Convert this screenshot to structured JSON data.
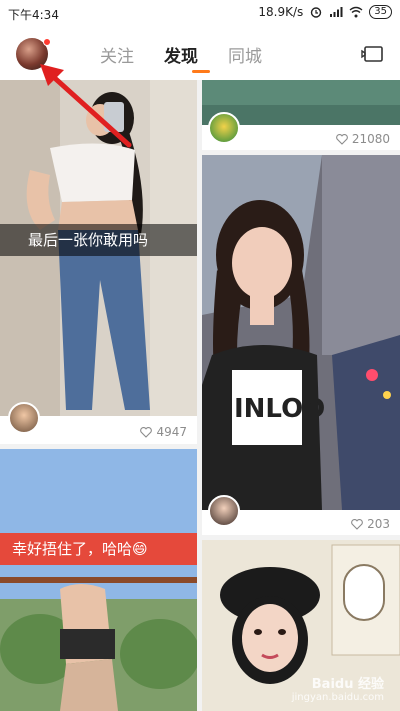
{
  "status_bar": {
    "time": "下午4:34",
    "speed": "18.9K/s",
    "battery": "35"
  },
  "nav": {
    "tabs": [
      {
        "label": "关注",
        "active": false
      },
      {
        "label": "发现",
        "active": true
      },
      {
        "label": "同城",
        "active": false
      }
    ],
    "accent": "#ff7a1a"
  },
  "feed": {
    "cards": [
      {
        "caption": "最后一张你敢用吗",
        "likes": "4947"
      },
      {
        "caption": "",
        "likes": "21080"
      },
      {
        "caption": "",
        "likes": "203"
      },
      {
        "caption": "幸好捂住了，哈哈😄",
        "likes": ""
      }
    ]
  },
  "watermark": {
    "title": "Baidu 经验",
    "url": "jingyan.baidu.com"
  }
}
